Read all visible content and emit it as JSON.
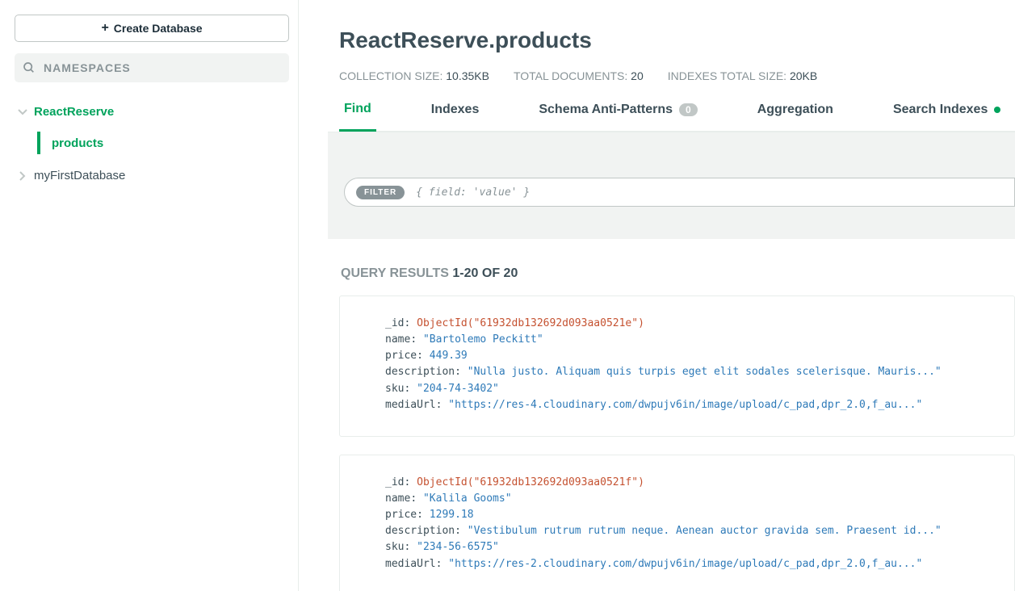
{
  "sidebar": {
    "create_label": "Create Database",
    "search_placeholder": "NAMESPACES",
    "db_active": "ReactReserve",
    "collection_active": "products",
    "db_other": "myFirstDatabase"
  },
  "header": {
    "title": "ReactReserve.products",
    "coll_size_label": "COLLECTION SIZE:",
    "coll_size_value": "10.35KB",
    "total_docs_label": "TOTAL DOCUMENTS:",
    "total_docs_value": "20",
    "idx_size_label": "INDEXES TOTAL SIZE:",
    "idx_size_value": "20KB"
  },
  "tabs": {
    "find": "Find",
    "indexes": "Indexes",
    "schema": "Schema Anti-Patterns",
    "schema_badge": "0",
    "aggregation": "Aggregation",
    "search": "Search Indexes"
  },
  "filter": {
    "pill": "FILTER",
    "placeholder": "{ field: 'value' }"
  },
  "results": {
    "label": "QUERY RESULTS",
    "range": "1-20 OF 20"
  },
  "docs": [
    {
      "_id": "ObjectId(\"61932db132692d093aa0521e\")",
      "name": "\"Bartolemo Peckitt\"",
      "price": "449.39",
      "description": "\"Nulla justo. Aliquam quis turpis eget elit sodales scelerisque. Mauris...\"",
      "sku": "\"204-74-3402\"",
      "mediaUrl": "\"https://res-4.cloudinary.com/dwpujv6in/image/upload/c_pad,dpr_2.0,f_au...\""
    },
    {
      "_id": "ObjectId(\"61932db132692d093aa0521f\")",
      "name": "\"Kalila Gooms\"",
      "price": "1299.18",
      "description": "\"Vestibulum rutrum rutrum neque. Aenean auctor gravida sem. Praesent id...\"",
      "sku": "\"234-56-6575\"",
      "mediaUrl": "\"https://res-2.cloudinary.com/dwpujv6in/image/upload/c_pad,dpr_2.0,f_au...\""
    }
  ]
}
